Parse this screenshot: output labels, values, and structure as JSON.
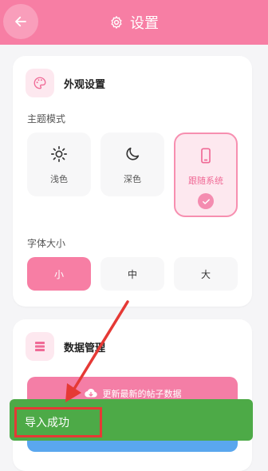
{
  "header": {
    "title": "设置"
  },
  "appearance": {
    "title": "外观设置",
    "theme_label": "主题模式",
    "themes": [
      {
        "label": "浅色",
        "icon": "sun-icon"
      },
      {
        "label": "深色",
        "icon": "moon-icon"
      },
      {
        "label": "跟随系统",
        "icon": "phone-icon",
        "selected": true
      }
    ],
    "font_size_label": "字体大小",
    "sizes": [
      {
        "label": "小",
        "selected": true
      },
      {
        "label": "中"
      },
      {
        "label": "大"
      }
    ]
  },
  "data_mgmt": {
    "title": "数据管理",
    "update_button": "更新最新的帖子数据"
  },
  "toast": {
    "message": "导入成功"
  },
  "colors": {
    "accent": "#f77ea4",
    "toast_bg": "#4daa47",
    "annotation": "#e53935",
    "secondary_button": "#5aa7ee"
  }
}
